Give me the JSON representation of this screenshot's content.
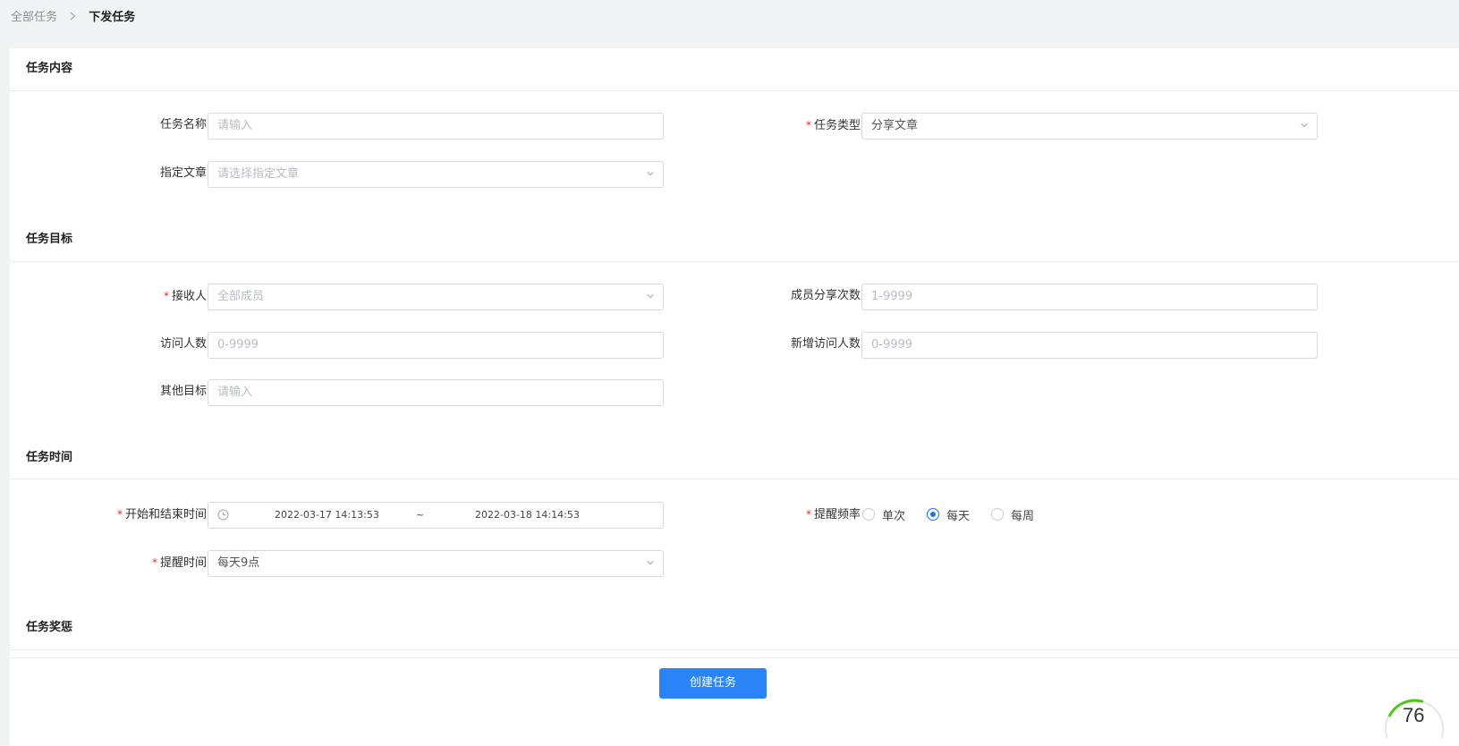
{
  "breadcrumb": {
    "parent": "全部任务",
    "current": "下发任务"
  },
  "sections": {
    "content": "任务内容",
    "target": "任务目标",
    "time": "任务时间",
    "reward": "任务奖惩"
  },
  "fields": {
    "task_name": {
      "label": "任务名称",
      "placeholder": "请输入"
    },
    "task_type": {
      "label": "任务类型",
      "value": "分享文章",
      "required": true
    },
    "article": {
      "label": "指定文章",
      "placeholder": "请选择指定文章"
    },
    "receiver": {
      "label": "接收人",
      "placeholder": "全部成员",
      "required": true
    },
    "share_count": {
      "label": "成员分享次数",
      "placeholder": "1-9999"
    },
    "visitors": {
      "label": "访问人数",
      "placeholder": "0-9999"
    },
    "new_visitors": {
      "label": "新增访问人数",
      "placeholder": "0-9999"
    },
    "other_goal": {
      "label": "其他目标",
      "placeholder": "请输入"
    },
    "time_range": {
      "label": "开始和结束时间",
      "start": "2022-03-17 14:13:53",
      "separator": "~",
      "end": "2022-03-18 14:14:53",
      "required": true
    },
    "remind_freq": {
      "label": "提醒频率",
      "required": true,
      "options": [
        "单次",
        "每天",
        "每周"
      ],
      "selected": "每天"
    },
    "remind_time": {
      "label": "提醒时间",
      "value": "每天9点",
      "required": true
    }
  },
  "footer": {
    "create_button": "创建任务"
  },
  "badge": {
    "text": "76"
  },
  "colors": {
    "primary": "#2b84f7",
    "required": "#f5222d",
    "radio_on": "#1a73e8"
  },
  "icons": [
    "chevron-right-icon",
    "chevron-down-icon",
    "clock-icon"
  ]
}
